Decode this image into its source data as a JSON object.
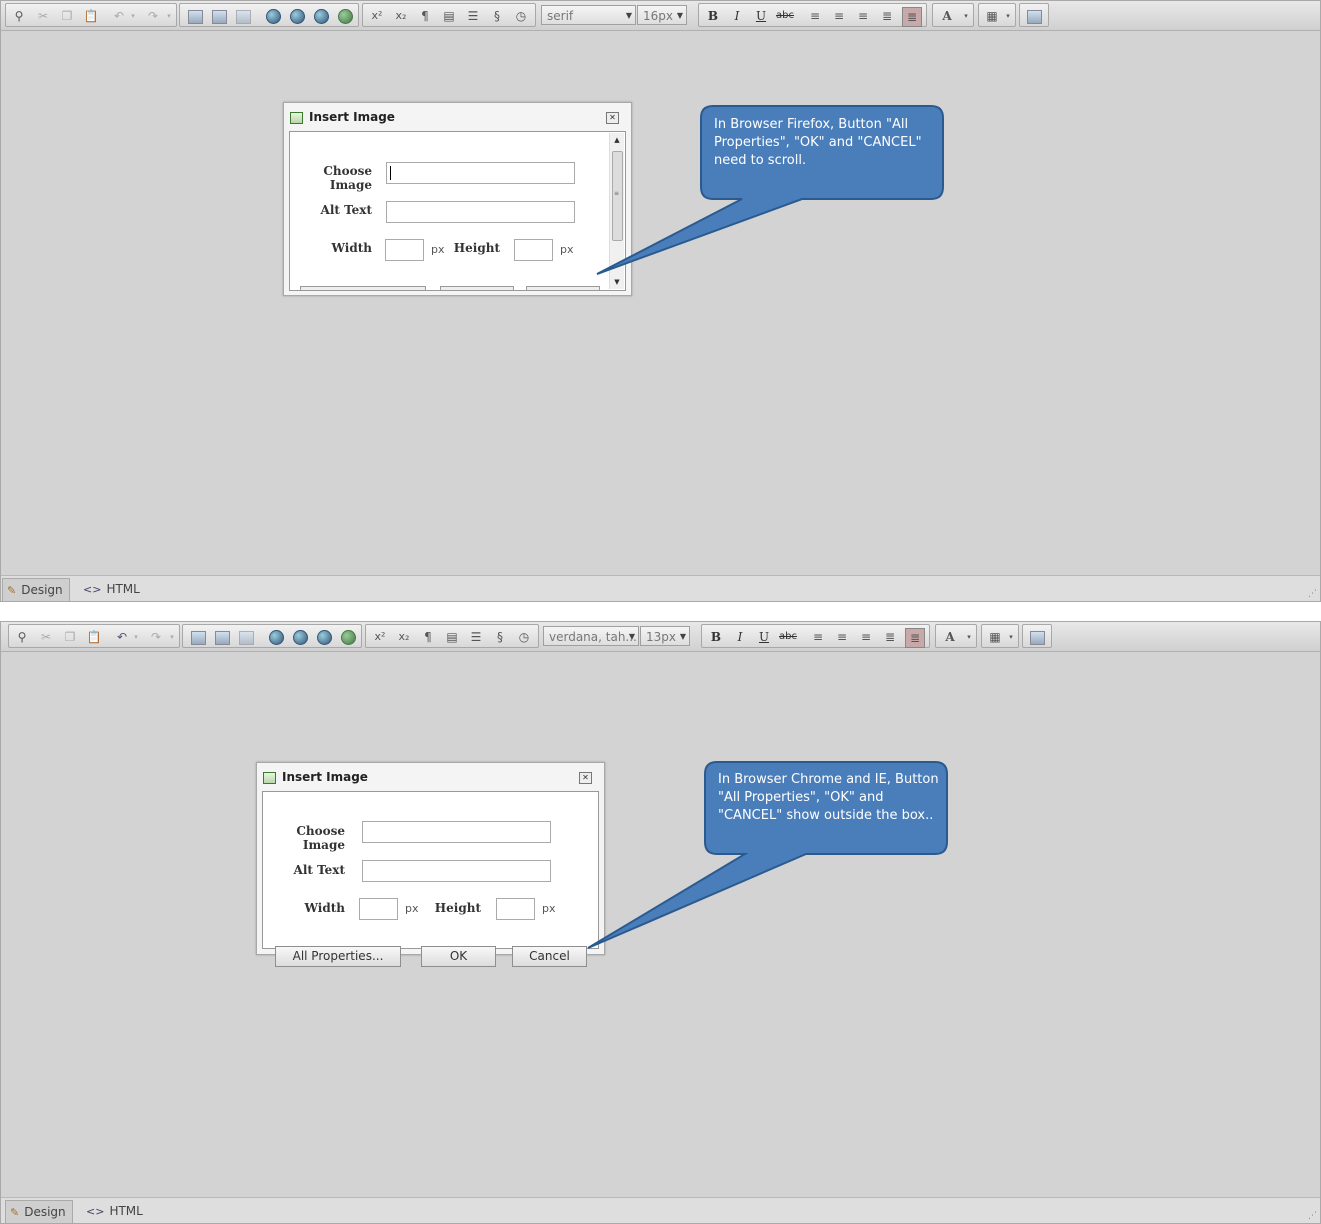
{
  "top_editor": {
    "toolbar": {
      "font_family": "serif",
      "font_size": "16px"
    },
    "dialog": {
      "title": "Insert Image",
      "choose_image_label": "Choose Image",
      "alt_text_label": "Alt Text",
      "width_label": "Width",
      "height_label": "Height",
      "px1": "px",
      "px2": "px"
    },
    "callout": "In Browser Firefox, Button \"All Properties\", \"OK\" and \"CANCEL\" need to scroll.",
    "tabs": {
      "design": "Design",
      "html": "HTML"
    }
  },
  "bottom_editor": {
    "toolbar": {
      "font_family": "verdana, tah...",
      "font_size": "13px"
    },
    "dialog": {
      "title": "Insert Image",
      "choose_image_label": "Choose Image",
      "alt_text_label": "Alt Text",
      "width_label": "Width",
      "height_label": "Height",
      "px1": "px",
      "px2": "px",
      "all_properties_button": "All Properties...",
      "ok_button": "OK",
      "cancel_button": "Cancel"
    },
    "callout": "In Browser Chrome and IE, Button \"All Properties\", \"OK\" and \"CANCEL\" show outside the box..",
    "tabs": {
      "design": "Design",
      "html": "HTML"
    }
  },
  "toolbar_icons": [
    "find-icon",
    "cut-icon",
    "copy-icon",
    "paste-icon",
    "undo-icon",
    "redo-icon",
    "image-icon",
    "image-map-icon",
    "flash-icon",
    "media-icon",
    "play-icon",
    "youtube-icon",
    "link-icon",
    "superscript-icon",
    "subscript-icon",
    "paragraph-icon",
    "template-icon",
    "align-icon",
    "special-char-icon",
    "date-time-icon",
    "bold-icon",
    "italic-icon",
    "underline-icon",
    "strike-icon",
    "align-left-icon",
    "align-center-icon",
    "align-right-icon",
    "justify-icon",
    "highlight-icon",
    "font-color-icon",
    "table-icon",
    "insert-image-icon"
  ],
  "colors": {
    "callout_fill": "#4a7ebb",
    "callout_border": "#2b5a8f",
    "editor_bg": "#d3d3d3"
  }
}
